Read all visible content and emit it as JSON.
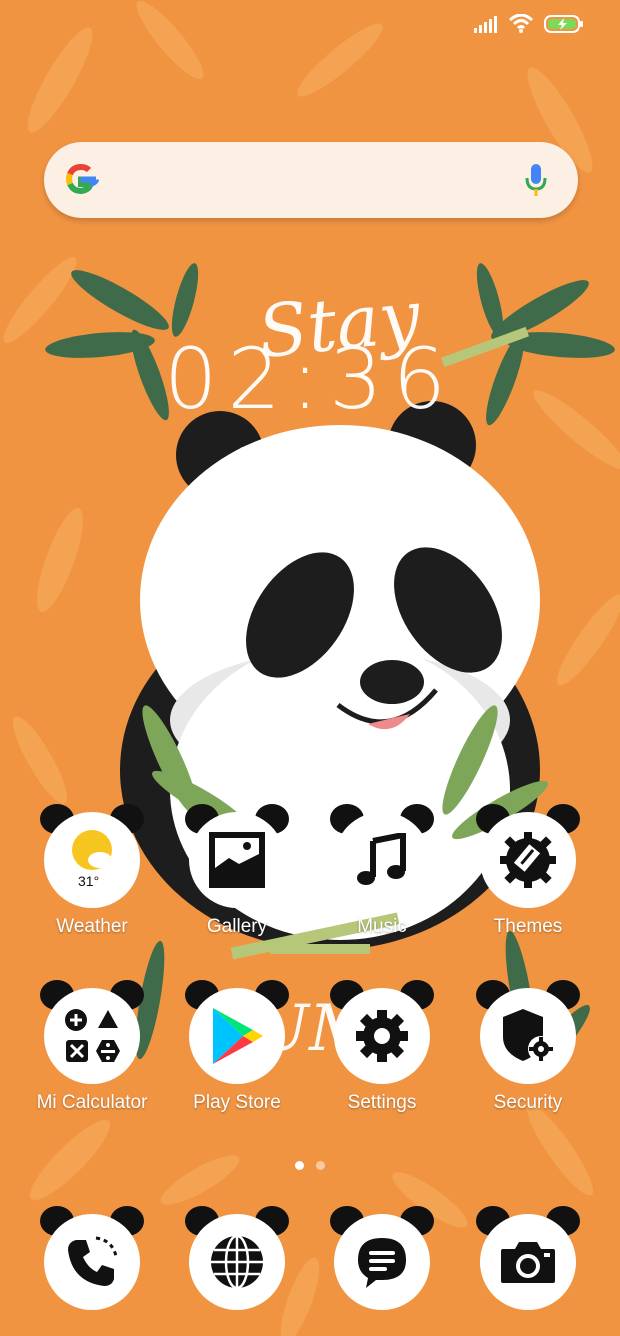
{
  "status_bar": {
    "signal_icon": "signal-bars-icon",
    "wifi_icon": "wifi-icon",
    "battery_icon": "battery-charging-icon"
  },
  "search": {
    "logo_icon": "google-logo-icon",
    "mic_icon": "mic-icon"
  },
  "widget": {
    "time": "02:36",
    "date_partial": "0",
    "wallpaper_text": "Stay"
  },
  "apps_row1": [
    {
      "label": "Weather",
      "icon": "weather-icon",
      "temp": "31°"
    },
    {
      "label": "Gallery",
      "icon": "gallery-icon"
    },
    {
      "label": "Music",
      "icon": "music-note-icon"
    },
    {
      "label": "Themes",
      "icon": "themes-brush-icon"
    }
  ],
  "apps_row2": [
    {
      "label": "Mi Calculator",
      "icon": "calculator-icon"
    },
    {
      "label": "Play Store",
      "icon": "play-store-icon"
    },
    {
      "label": "Settings",
      "icon": "gear-icon"
    },
    {
      "label": "Security",
      "icon": "security-shield-icon"
    }
  ],
  "dock": [
    {
      "icon": "phone-icon"
    },
    {
      "icon": "browser-globe-icon"
    },
    {
      "icon": "messages-icon"
    },
    {
      "icon": "camera-icon"
    }
  ],
  "page_indicator": {
    "pages": 2,
    "current": 1
  },
  "colors": {
    "wallpaper": "#f19442",
    "icon_bg": "#ffffff",
    "ear": "#111111"
  }
}
